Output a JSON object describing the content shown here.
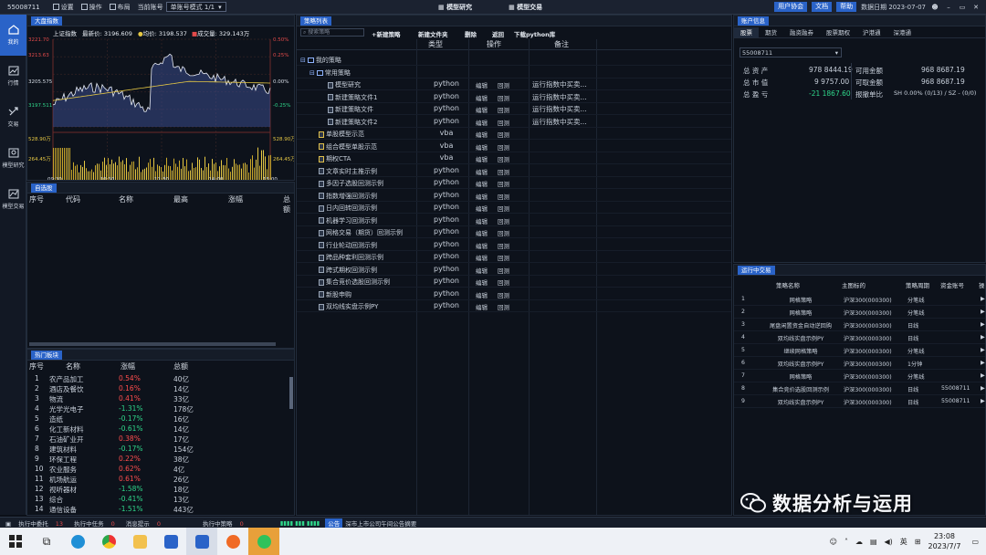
{
  "topbar": {
    "account": "55008711",
    "settings": "设置",
    "operate": "操作",
    "layout": "布局",
    "current_account_label": "当前账号",
    "mode_select": "单账号模式 1/1",
    "center_tabs": [
      "模型研究",
      "模型交易"
    ],
    "user_help": "用户协会",
    "doc": "文档",
    "help": "帮助",
    "data_date": "数据日期 2023-07-07"
  },
  "leftnav": {
    "items": [
      {
        "label": "我的",
        "icon": "home-icon",
        "active": true
      },
      {
        "label": "行情",
        "icon": "chart-icon",
        "active": false
      },
      {
        "label": "交易",
        "icon": "trade-icon",
        "active": false
      },
      {
        "label": "模型研究",
        "icon": "research-icon",
        "active": false
      },
      {
        "label": "模型交易",
        "icon": "model-trade-icon",
        "active": false
      }
    ]
  },
  "index": {
    "tab": "大盘指数",
    "name": "上证指数",
    "latest_label": "最新价",
    "latest": "3196.609",
    "avg_label": "均价",
    "avg": "3198.537",
    "vol_label": "成交量",
    "vol": "329.143万",
    "left_ticks": [
      "3221.70",
      "3213.63",
      "3205.575",
      "3197.511",
      "528.90万",
      "264.45万"
    ],
    "right_ticks": [
      "0.50%",
      "0.25%",
      "0.00%",
      "-0.25%",
      "528.90万",
      "264.45万"
    ],
    "time_ticks": [
      "09:30",
      "10:30",
      "11:30",
      "14:00",
      "15:00"
    ]
  },
  "watch": {
    "tab": "自选股",
    "headers": [
      "序号",
      "代码",
      "名称",
      "最高",
      "涨幅",
      "总额"
    ]
  },
  "hot": {
    "tab": "热门板块",
    "headers": [
      "序号",
      "名称",
      "涨幅",
      "总额"
    ],
    "rows": [
      [
        "1",
        "农产品加工",
        "0.54%",
        "40亿",
        "up"
      ],
      [
        "2",
        "酒店及餐饮",
        "0.16%",
        "14亿",
        "up"
      ],
      [
        "3",
        "物流",
        "0.41%",
        "33亿",
        "up"
      ],
      [
        "4",
        "光学光电子",
        "-1.31%",
        "178亿",
        "dn"
      ],
      [
        "5",
        "造纸",
        "-0.17%",
        "16亿",
        "dn"
      ],
      [
        "6",
        "化工新材料",
        "-0.61%",
        "14亿",
        "dn"
      ],
      [
        "7",
        "石油矿业开",
        "0.38%",
        "17亿",
        "up"
      ],
      [
        "8",
        "建筑材料",
        "-0.17%",
        "154亿",
        "dn"
      ],
      [
        "9",
        "环保工程",
        "0.22%",
        "38亿",
        "up"
      ],
      [
        "10",
        "农业服务",
        "0.62%",
        "4亿",
        "up"
      ],
      [
        "11",
        "机场航运",
        "0.61%",
        "26亿",
        "up"
      ],
      [
        "12",
        "视听器材",
        "-1.58%",
        "18亿",
        "dn"
      ],
      [
        "13",
        "综合",
        "-0.41%",
        "13亿",
        "dn"
      ],
      [
        "14",
        "通信设备",
        "-1.51%",
        "443亿",
        "dn"
      ]
    ]
  },
  "strat": {
    "tab": "策略列表",
    "search_placeholder": "搜索策略",
    "buttons": [
      "+新建策略",
      "新建文件夹",
      "删除",
      "返回",
      "下载python库"
    ],
    "headers": [
      "类型",
      "操作",
      "备注"
    ],
    "rows": [
      {
        "name": "我的策略",
        "type": "",
        "ops": false,
        "note": "",
        "indent": 0,
        "kind": "folder"
      },
      {
        "name": "常用策略",
        "type": "",
        "ops": false,
        "note": "",
        "indent": 1,
        "kind": "folder"
      },
      {
        "name": "模型研究",
        "type": "python",
        "ops": true,
        "note": "运行指数中买卖...",
        "indent": 2,
        "kind": "file"
      },
      {
        "name": "新建策略文件1",
        "type": "python",
        "ops": true,
        "note": "运行指数中买卖...",
        "indent": 2,
        "kind": "file"
      },
      {
        "name": "新建策略文件",
        "type": "python",
        "ops": true,
        "note": "运行指数中买卖...",
        "indent": 2,
        "kind": "file"
      },
      {
        "name": "新建策略文件2",
        "type": "python",
        "ops": true,
        "note": "运行指数中买卖...",
        "indent": 2,
        "kind": "file"
      },
      {
        "name": "单股模型示范",
        "type": "vba",
        "ops": true,
        "note": "",
        "indent": 1,
        "kind": "vba"
      },
      {
        "name": "组合模型单股示范",
        "type": "vba",
        "ops": true,
        "note": "",
        "indent": 1,
        "kind": "vba"
      },
      {
        "name": "期权CTA",
        "type": "vba",
        "ops": true,
        "note": "",
        "indent": 1,
        "kind": "vba"
      },
      {
        "name": "文章实时主推示例",
        "type": "python",
        "ops": true,
        "note": "",
        "indent": 1,
        "kind": "file"
      },
      {
        "name": "多因子选股回测示例",
        "type": "python",
        "ops": true,
        "note": "",
        "indent": 1,
        "kind": "file"
      },
      {
        "name": "指数增强回测示例",
        "type": "python",
        "ops": true,
        "note": "",
        "indent": 1,
        "kind": "file"
      },
      {
        "name": "日内回转回测示例",
        "type": "python",
        "ops": true,
        "note": "",
        "indent": 1,
        "kind": "file"
      },
      {
        "name": "机器学习回测示例",
        "type": "python",
        "ops": true,
        "note": "",
        "indent": 1,
        "kind": "file"
      },
      {
        "name": "网格交易（期货）回测示例",
        "type": "python",
        "ops": true,
        "note": "",
        "indent": 1,
        "kind": "file"
      },
      {
        "name": "行业轮动回测示例",
        "type": "python",
        "ops": true,
        "note": "",
        "indent": 1,
        "kind": "file"
      },
      {
        "name": "跨品种套利回测示例",
        "type": "python",
        "ops": true,
        "note": "",
        "indent": 1,
        "kind": "file"
      },
      {
        "name": "跨式期权回测示例",
        "type": "python",
        "ops": true,
        "note": "",
        "indent": 1,
        "kind": "file"
      },
      {
        "name": "集合竞价选股回测示例",
        "type": "python",
        "ops": true,
        "note": "",
        "indent": 1,
        "kind": "file"
      },
      {
        "name": "新股申购",
        "type": "python",
        "ops": true,
        "note": "",
        "indent": 1,
        "kind": "file"
      },
      {
        "name": "双均线实盘示例PY",
        "type": "python",
        "ops": true,
        "note": "",
        "indent": 1,
        "kind": "file"
      }
    ],
    "op_edit": "编辑",
    "op_backtest": "回测"
  },
  "acct": {
    "tab": "账户信息",
    "subtabs": [
      "股票",
      "期货",
      "融资融券",
      "股票期权",
      "沪港通",
      "深港通"
    ],
    "account": "55008711",
    "total_assets_label": "总 资 产",
    "total_assets": "978 8444.19",
    "market_value_label": "总 市 值",
    "market_value": "9 9757.00",
    "pnl_label": "总 盈 亏",
    "pnl": "-21 1867.60",
    "available_label": "可用金额",
    "available": "968 8687.19",
    "withdrawable_label": "可取金额",
    "withdrawable": "968 8687.19",
    "order_ratio_label": "报撤单比",
    "order_ratio": "SH 0.00% (0/13) / SZ - (0/0)"
  },
  "run": {
    "tab": "运行中交易",
    "headers": [
      "策略名称",
      "主图标的",
      "策略周期",
      "资金账号",
      "操"
    ],
    "rows": [
      [
        "1",
        "网格策略",
        "沪深300(000300)",
        "分笔线",
        ""
      ],
      [
        "2",
        "网格策略",
        "沪深300(000300)",
        "分笔线",
        ""
      ],
      [
        "3",
        "尾盘闲置资金自动逆回购",
        "沪深300(000300)",
        "日线",
        ""
      ],
      [
        "4",
        "双均线实盘示例PY",
        "沪深300(000300)",
        "日线",
        ""
      ],
      [
        "5",
        "继续网格策略",
        "沪深300(000300)",
        "分笔线",
        ""
      ],
      [
        "6",
        "双均线实盘示例PY",
        "沪深300(000300)",
        "1分钟",
        ""
      ],
      [
        "7",
        "网格策略",
        "沪深300(000300)",
        "分笔线",
        ""
      ],
      [
        "8",
        "集合竞价选股回测示例",
        "沪深300(000300)",
        "日线",
        "55008711"
      ],
      [
        "9",
        "双均线实盘示例PY",
        "沪深300(000300)",
        "日线",
        "55008711"
      ]
    ]
  },
  "status": {
    "executing_orders_label": "执行中委托",
    "executing_orders": "13",
    "executing_tasks_label": "执行中任务",
    "executing_tasks": "0",
    "messages_label": "消息提示",
    "messages": "0",
    "executing_strats_label": "执行中策略",
    "executing_strats": "0",
    "notice_label": "公告",
    "notice_text": "深市上市公司午间公告摘要"
  },
  "watermark": "数据分析与运用",
  "taskbar": {
    "time": "23:08",
    "date": "2023/7/7",
    "ime": "英"
  }
}
